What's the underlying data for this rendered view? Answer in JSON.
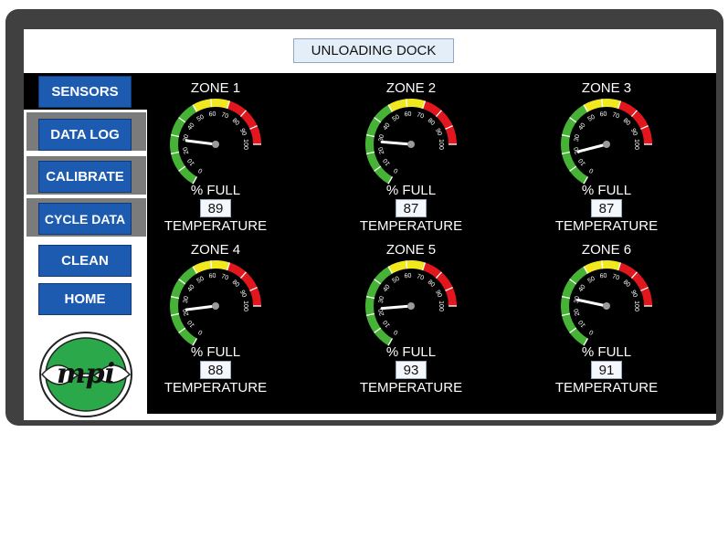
{
  "header": {
    "title": "UNLOADING DOCK"
  },
  "nav": [
    {
      "label": "SENSORS",
      "name": "sensors"
    },
    {
      "label": "DATA LOG",
      "name": "data-log"
    },
    {
      "label": "CALIBRATE",
      "name": "calibrate"
    },
    {
      "label": "CYCLE DATA",
      "name": "cycle-data"
    },
    {
      "label": "CLEAN",
      "name": "clean"
    },
    {
      "label": "HOME",
      "name": "home"
    }
  ],
  "gauge_common": {
    "unit_label": "% FULL",
    "reading_label": "TEMPERATURE",
    "ticks": [
      "0",
      "10",
      "20",
      "30",
      "40",
      "50",
      "60",
      "70",
      "80",
      "90",
      "100"
    ]
  },
  "zones": [
    {
      "label": "ZONE 1",
      "fill_percent": 28,
      "value": "89"
    },
    {
      "label": "ZONE 2",
      "fill_percent": 27,
      "value": "87"
    },
    {
      "label": "ZONE 3",
      "fill_percent": 19,
      "value": "87"
    },
    {
      "label": "ZONE 4",
      "fill_percent": 22,
      "value": "88"
    },
    {
      "label": "ZONE 5",
      "fill_percent": 23,
      "value": "93"
    },
    {
      "label": "ZONE 6",
      "fill_percent": 30,
      "value": "91"
    }
  ],
  "logo": {
    "text": "mpi"
  },
  "colors": {
    "bezel": "#404040",
    "panel": "#000000",
    "nav_button": "#1c5bb0",
    "gauge_green": "#47b336",
    "gauge_yellow": "#f2e81f",
    "gauge_red": "#e2161d",
    "logo_green": "#2aa84a"
  }
}
